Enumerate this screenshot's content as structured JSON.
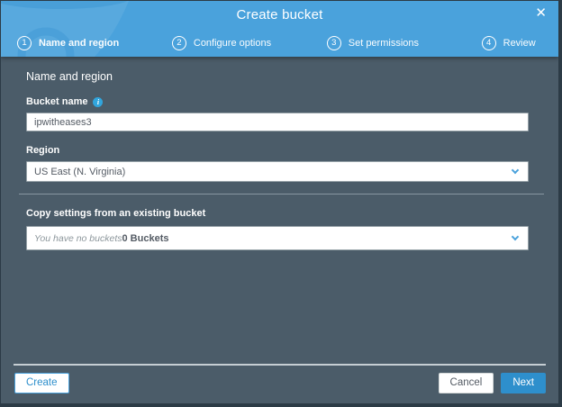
{
  "modal": {
    "title": "Create bucket"
  },
  "icons": {
    "close": "✕",
    "info": "i"
  },
  "stepper": {
    "steps": [
      {
        "number": "1",
        "label": "Name and region",
        "active": true
      },
      {
        "number": "2",
        "label": "Configure options",
        "active": false
      },
      {
        "number": "3",
        "label": "Set permissions",
        "active": false
      },
      {
        "number": "4",
        "label": "Review",
        "active": false
      }
    ]
  },
  "form": {
    "section_heading": "Name and region",
    "bucket_name": {
      "label": "Bucket name",
      "value": "ipwitheases3"
    },
    "region": {
      "label": "Region",
      "selected": "US East (N. Virginia)"
    },
    "copy_settings": {
      "label": "Copy settings from an existing bucket",
      "placeholder_italic": "You have no buckets",
      "placeholder_suffix": "0 Buckets"
    }
  },
  "footer": {
    "create_label": "Create",
    "cancel_label": "Cancel",
    "next_label": "Next"
  },
  "colors": {
    "header_blue": "#4aa2dc",
    "watermark_blue": "#3e97d3",
    "body_slate": "#4b5c69",
    "accent_blue": "#2e8fcc",
    "frame_dark": "#2c3b46",
    "field_text": "#545b64",
    "muted_text": "#8d979c"
  }
}
